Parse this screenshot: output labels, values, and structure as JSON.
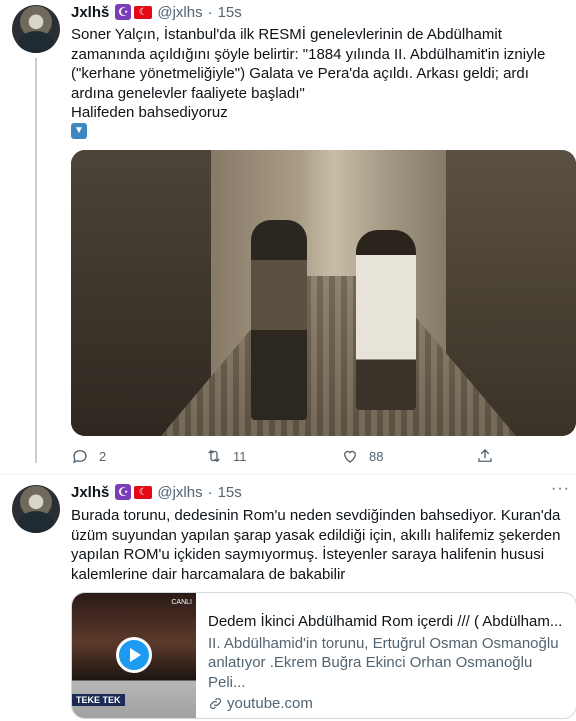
{
  "tweets": [
    {
      "name": "Jxlhš",
      "moon_emoji": "☪",
      "flag_emoji": "☾",
      "handle": "@jxlhs",
      "dot": "·",
      "time": "15s",
      "text": "Soner Yalçın, İstanbul'da ilk RESMİ genelevlerinin de Abdülhamit zamanında açıldığını şöyle belirtir: \"1884 yılında II. Abdülhamit'in izniyle (\"kerhane yönetmeliğiyle\") Galata ve Pera'da açıldı. Arkası geldi; ardı ardına genelevler faaliyete başladı\"\nHalifeden bahsediyoruz",
      "down_emoji": "▼",
      "reply_count": "2",
      "retweet_count": "11",
      "like_count": "88"
    },
    {
      "name": "Jxlhš",
      "moon_emoji": "☪",
      "flag_emoji": "☾",
      "handle": "@jxlhs",
      "dot": "·",
      "time": "15s",
      "more": "···",
      "text": "Burada torunu, dedesinin Rom'u neden sevdiğinden bahsediyor. Kuran'da üzüm suyundan yapılan şarap yasak edildiği için, akıllı halifemiz şekerden yapılan ROM'u içkiden saymıyormuş. İsteyenler saraya halifenin hususi kalemlerine dair harcamalara de bakabilir",
      "card": {
        "thumb_badge": "TEKE TEK",
        "thumb_channel": "CANLI",
        "title": "Dedem İkinci Abdülhamid Rom içerdi /// ( Abdülham...",
        "description": "II. Abdülhamid'in torunu, Ertuğrul Osman Osmanoğlu anlatıyor .Ekrem Buğra Ekinci Orhan Osmanoğlu Peli...",
        "domain": "youtube.com"
      }
    }
  ],
  "icons": {
    "reply": "reply-icon",
    "retweet": "retweet-icon",
    "like": "like-icon",
    "share": "share-icon",
    "link": "link-icon",
    "play": "play-icon"
  },
  "colors": {
    "text": "#0f1419",
    "secondary": "#536471",
    "accent": "#1d9bf0",
    "divider": "#eff3f4"
  }
}
